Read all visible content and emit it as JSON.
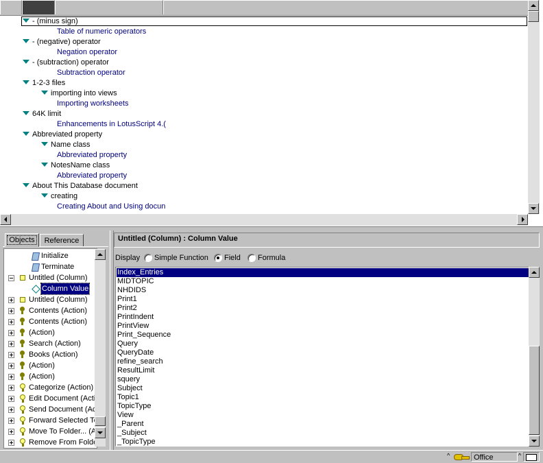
{
  "view": {
    "rows": [
      {
        "text": "- (minus sign)",
        "kind": "cat",
        "level": 0
      },
      {
        "text": "Table of numeric operators",
        "kind": "doc",
        "level": 2
      },
      {
        "text": "- (negative) operator",
        "kind": "cat",
        "level": 0
      },
      {
        "text": "Negation operator",
        "kind": "doc",
        "level": 2
      },
      {
        "text": "- (subtraction) operator",
        "kind": "cat",
        "level": 0
      },
      {
        "text": "Subtraction operator",
        "kind": "doc",
        "level": 2
      },
      {
        "text": "1-2-3 files",
        "kind": "cat",
        "level": 0
      },
      {
        "text": "importing into views",
        "kind": "cat",
        "level": 1
      },
      {
        "text": "Importing worksheets",
        "kind": "doc",
        "level": 2
      },
      {
        "text": "64K limit",
        "kind": "cat",
        "level": 0
      },
      {
        "text": "Enhancements in LotusScript 4.(",
        "kind": "doc",
        "level": 2
      },
      {
        "text": "Abbreviated property",
        "kind": "cat",
        "level": 0
      },
      {
        "text": "Name class",
        "kind": "cat",
        "level": 1
      },
      {
        "text": "Abbreviated property",
        "kind": "doc",
        "level": 2
      },
      {
        "text": "NotesName class",
        "kind": "cat",
        "level": 1
      },
      {
        "text": "Abbreviated property",
        "kind": "doc",
        "level": 2
      },
      {
        "text": "About This Database document",
        "kind": "cat",
        "level": 0
      },
      {
        "text": "creating",
        "kind": "cat",
        "level": 1
      },
      {
        "text": "Creating About and Using docun",
        "kind": "doc",
        "level": 2
      }
    ]
  },
  "tabs": {
    "objects": "Objects",
    "reference": "Reference"
  },
  "objects": {
    "items": [
      {
        "label": "Initialize",
        "icon": "script-icon",
        "expander": "none",
        "indent": 1
      },
      {
        "label": "Terminate",
        "icon": "script-icon",
        "expander": "none",
        "indent": 1
      },
      {
        "label": "Untitled (Column)",
        "icon": "column-icon",
        "expander": "minus",
        "indent": 0
      },
      {
        "label": "Column Value",
        "icon": "value-icon",
        "expander": "none",
        "indent": 1,
        "selected": true
      },
      {
        "label": "Untitled (Column)",
        "icon": "column-icon",
        "expander": "plus",
        "indent": 0
      },
      {
        "label": "Contents (Action)",
        "icon": "action-icon",
        "expander": "plus",
        "indent": 0
      },
      {
        "label": "Contents (Action)",
        "icon": "action-icon",
        "expander": "plus",
        "indent": 0
      },
      {
        "label": "(Action)",
        "icon": "action-icon",
        "expander": "plus",
        "indent": 0
      },
      {
        "label": "Search (Action)",
        "icon": "action-icon",
        "expander": "plus",
        "indent": 0
      },
      {
        "label": "Books (Action)",
        "icon": "action-icon",
        "expander": "plus",
        "indent": 0
      },
      {
        "label": "(Action)",
        "icon": "action-icon",
        "expander": "plus",
        "indent": 0
      },
      {
        "label": "(Action)",
        "icon": "action-icon",
        "expander": "plus",
        "indent": 0
      },
      {
        "label": "Categorize (Action)",
        "icon": "system-action-icon",
        "expander": "plus",
        "indent": 0
      },
      {
        "label": "Edit Document (Actio",
        "icon": "system-action-icon",
        "expander": "plus",
        "indent": 0
      },
      {
        "label": "Send Document (Ac",
        "icon": "system-action-icon",
        "expander": "plus",
        "indent": 0
      },
      {
        "label": "Forward Selected To",
        "icon": "system-action-icon",
        "expander": "plus",
        "indent": 0
      },
      {
        "label": "Move To Folder... (A",
        "icon": "system-action-icon",
        "expander": "plus",
        "indent": 0
      },
      {
        "label": "Remove From Folde",
        "icon": "system-action-icon",
        "expander": "plus",
        "indent": 0
      }
    ]
  },
  "editor": {
    "title": "Untitled (Column) : Column Value",
    "display_label": "Display",
    "options": [
      {
        "label": "Simple Function",
        "checked": false
      },
      {
        "label": "Field",
        "checked": true
      },
      {
        "label": "Formula",
        "checked": false
      }
    ],
    "fields": [
      "Index_Entries",
      "MIDTOPIC",
      "NHDIDS",
      "Print1",
      "Print2",
      "PrintIndent",
      "PrintView",
      "Print_Sequence",
      "Query",
      "QueryDate",
      "refine_search",
      "ResultLimit",
      "squery",
      "Subject",
      "Topic1",
      "TopicType",
      "View",
      "_Parent",
      "_Subject",
      "_TopicType"
    ],
    "selected_field": "Index_Entries"
  },
  "status": {
    "location": "Office"
  }
}
